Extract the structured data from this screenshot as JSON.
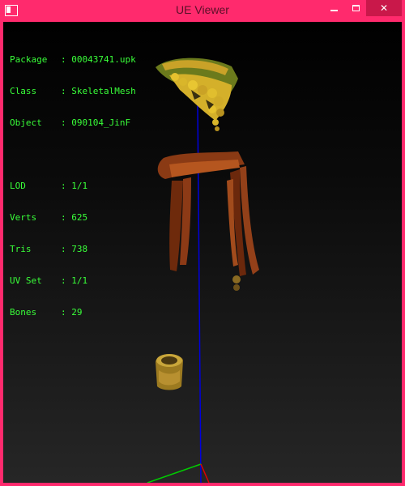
{
  "window": {
    "title": "UE Viewer"
  },
  "info": {
    "package": {
      "label": "Package",
      "value": "00043741.upk"
    },
    "class": {
      "label": "Class",
      "value": "SkeletalMesh"
    },
    "object": {
      "label": "Object",
      "value": "090104_JinF"
    },
    "lod": {
      "label": "LOD",
      "value": "1/1"
    },
    "verts": {
      "label": "Verts",
      "value": "625"
    },
    "tris": {
      "label": "Tris",
      "value": "738"
    },
    "uvset": {
      "label": "UV Set",
      "value": "1/1"
    },
    "bones": {
      "label": "Bones",
      "value": "29"
    }
  },
  "colors": {
    "frame": "#ff2a6d",
    "info_text": "#39ff39",
    "axis_y": "#0000dd"
  }
}
